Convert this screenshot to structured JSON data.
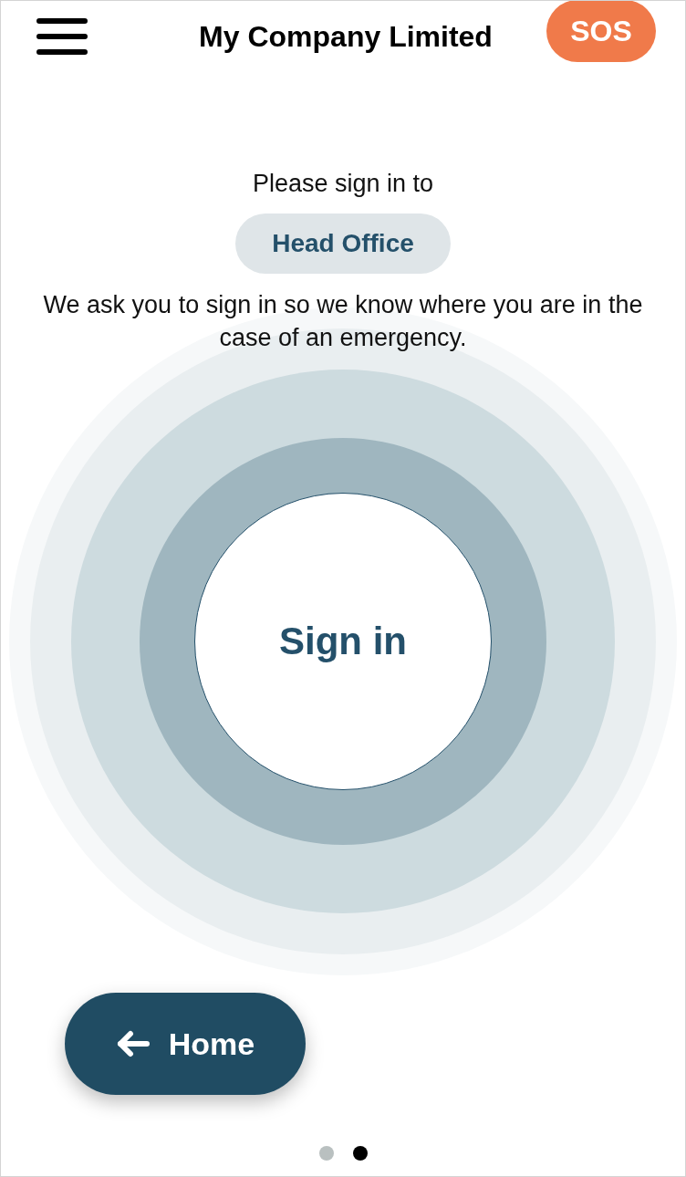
{
  "header": {
    "title": "My Company Limited",
    "sos": "SOS"
  },
  "prompt": "Please sign in to",
  "location": "Head Office",
  "explanation": "We ask you to sign in so we know where you are in the case of an emergency.",
  "sign_in": "Sign in",
  "home": "Home",
  "pages": [
    {
      "selected": false
    },
    {
      "selected": true
    }
  ]
}
